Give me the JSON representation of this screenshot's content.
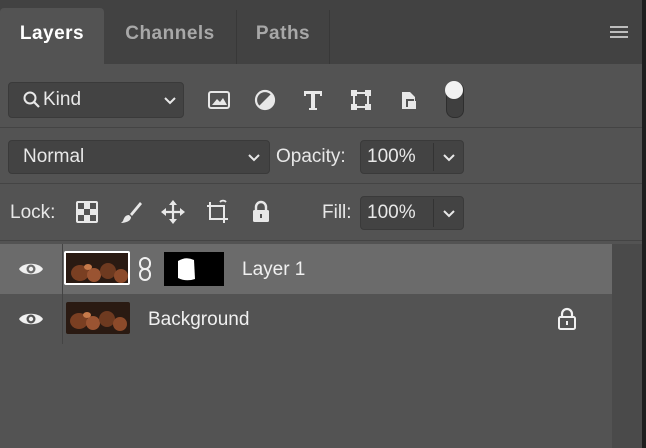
{
  "tabs": [
    {
      "label": "Layers",
      "active": true
    },
    {
      "label": "Channels",
      "active": false
    },
    {
      "label": "Paths",
      "active": false
    }
  ],
  "filter": {
    "kind_label": "Kind",
    "filter_icons": [
      "image-filter-icon",
      "adjustment-filter-icon",
      "type-filter-icon",
      "shape-filter-icon",
      "smart-object-filter-icon",
      "filter-toggle-icon"
    ]
  },
  "blend": {
    "mode": "Normal",
    "opacity_label": "Opacity:",
    "opacity_value": "100%"
  },
  "lock": {
    "lock_label": "Lock:",
    "lock_icons": [
      "lock-transparent-pixels-icon",
      "lock-image-pixels-icon",
      "lock-position-icon",
      "lock-artboard-icon",
      "lock-all-icon"
    ],
    "fill_label": "Fill:",
    "fill_value": "100%"
  },
  "layers": [
    {
      "name": "Layer 1",
      "visible": true,
      "selected": true,
      "has_mask": true,
      "locked": false
    },
    {
      "name": "Background",
      "visible": true,
      "selected": false,
      "has_mask": false,
      "locked": true
    }
  ],
  "colors": {
    "panel_bg": "#535353",
    "tabbar_bg": "#424242",
    "selected_row": "#6b6b6b",
    "field_bg": "#434343"
  }
}
